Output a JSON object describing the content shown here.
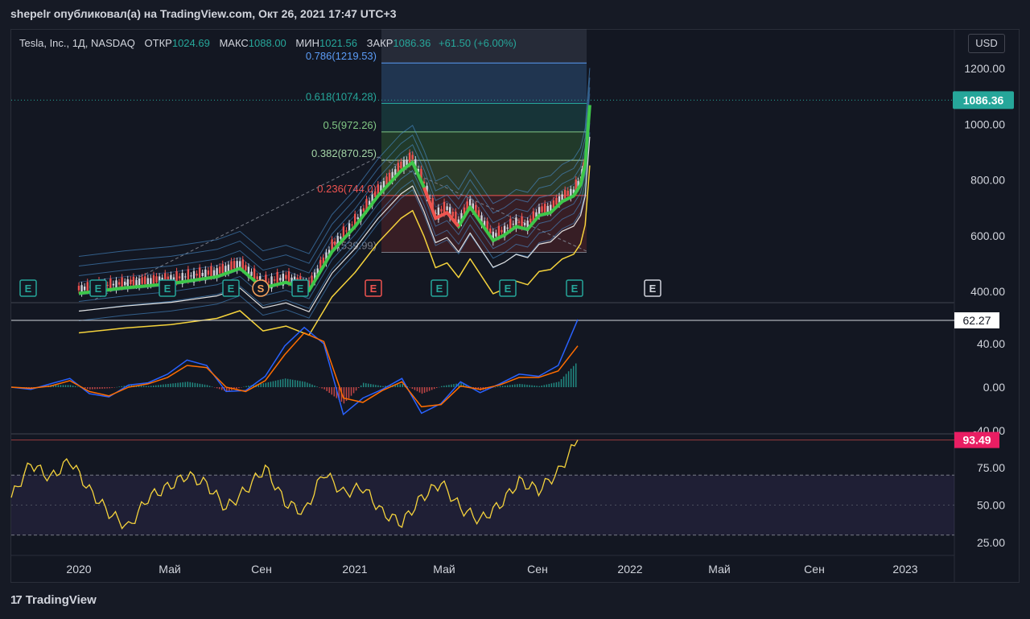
{
  "header": {
    "text": "shepelr опубликовал(а) на TradingView.com, Окт 26, 2021 17:47 UTC+3"
  },
  "legend": {
    "symbol": "Tesla, Inc., 1Д, NASDAQ",
    "open_label": "ОТКР",
    "open": "1024.69",
    "high_label": "МАКС",
    "high": "1088.00",
    "low_label": "МИН",
    "low": "1021.56",
    "close_label": "ЗАКР",
    "close": "1086.36",
    "change": "+61.50 (+6.00%)"
  },
  "currency": "USD",
  "footer": {
    "brand": "TradingView",
    "logo": "17"
  },
  "colors": {
    "bg": "#131722",
    "up": "#26a69a",
    "down": "#ef5350",
    "rsi": "#f5d33c",
    "macd": "#2962ff",
    "signal": "#ff6d00"
  },
  "events": [
    {
      "label": "E",
      "type": "earnings"
    },
    {
      "label": "E",
      "type": "earnings"
    },
    {
      "label": "E",
      "type": "earnings"
    },
    {
      "label": "E",
      "type": "earnings"
    },
    {
      "label": "S",
      "type": "split"
    },
    {
      "label": "E",
      "type": "earnings"
    },
    {
      "label": "E",
      "type": "earnings-negative"
    },
    {
      "label": "E",
      "type": "earnings"
    },
    {
      "label": "E",
      "type": "earnings"
    },
    {
      "label": "E",
      "type": "earnings"
    },
    {
      "label": "E",
      "type": "earnings-upcoming"
    }
  ],
  "chart_data": [
    {
      "type": "candlestick",
      "title": "Tesla, Inc., 1Д, NASDAQ",
      "y_ticks": [
        "1200.00",
        "1000.00",
        "800.00",
        "600.00",
        "400.00"
      ],
      "ylim": [
        380,
        1240
      ],
      "last_price": "1086.36",
      "fib_levels": [
        {
          "label": "0.786(1219.53)",
          "value": 1219.53,
          "color": "#5b9cf6"
        },
        {
          "label": "0.618(1074.28)",
          "value": 1074.28,
          "color": "#26a69a"
        },
        {
          "label": "0.5(972.26)",
          "value": 972.26,
          "color": "#81c784"
        },
        {
          "label": "0.382(870.25)",
          "value": 870.25,
          "color": "#a5d6a7"
        },
        {
          "label": "0.236(744.0)",
          "value": 744.0,
          "color": "#ef5350"
        },
        {
          "label": "0(539.99)",
          "value": 539.99,
          "color": "#787b86"
        }
      ],
      "price_path": [
        {
          "m": 0,
          "p": 410
        },
        {
          "m": 2,
          "p": 430
        },
        {
          "m": 4,
          "p": 445
        },
        {
          "m": 6,
          "p": 470
        },
        {
          "m": 7,
          "p": 500
        },
        {
          "m": 8,
          "p": 430
        },
        {
          "m": 9,
          "p": 450
        },
        {
          "m": 10,
          "p": 420
        },
        {
          "m": 11,
          "p": 560
        },
        {
          "m": 12,
          "p": 650
        },
        {
          "m": 13,
          "p": 760
        },
        {
          "m": 14,
          "p": 850
        },
        {
          "m": 14.5,
          "p": 880
        },
        {
          "m": 15,
          "p": 790
        },
        {
          "m": 15.5,
          "p": 680
        },
        {
          "m": 16,
          "p": 700
        },
        {
          "m": 16.5,
          "p": 650
        },
        {
          "m": 17,
          "p": 720
        },
        {
          "m": 17.5,
          "p": 660
        },
        {
          "m": 18,
          "p": 600
        },
        {
          "m": 18.5,
          "p": 620
        },
        {
          "m": 19,
          "p": 650
        },
        {
          "m": 19.5,
          "p": 640
        },
        {
          "m": 20,
          "p": 690
        },
        {
          "m": 20.5,
          "p": 700
        },
        {
          "m": 21,
          "p": 740
        },
        {
          "m": 21.5,
          "p": 760
        },
        {
          "m": 21.8,
          "p": 800
        },
        {
          "m": 22,
          "p": 870
        },
        {
          "m": 22.2,
          "p": 1086
        }
      ]
    },
    {
      "type": "line",
      "indicator": "MACD",
      "y_ticks": [
        "40.00",
        "0.00",
        "-40.00"
      ],
      "ylim": [
        -45,
        68
      ],
      "last_value": "62.27",
      "series": [
        {
          "values": [
            0,
            -2,
            3,
            8,
            -6,
            -9,
            2,
            4,
            12,
            25,
            20,
            -4,
            -3,
            10,
            38,
            55,
            40,
            -25,
            -10,
            -2,
            8,
            -24,
            -15,
            5,
            -5,
            3,
            12,
            10,
            20,
            62.27
          ],
          "color": "#2962ff"
        },
        {
          "values": [
            0,
            -1,
            1,
            6,
            -4,
            -8,
            0,
            3,
            9,
            20,
            18,
            0,
            -4,
            6,
            30,
            50,
            42,
            -10,
            -14,
            -3,
            5,
            -18,
            -16,
            1,
            -2,
            2,
            9,
            9,
            15,
            38
          ],
          "color": "#ff6d00"
        }
      ]
    },
    {
      "type": "line",
      "indicator": "RSI",
      "y_ticks": [
        "75.00",
        "50.00",
        "25.00"
      ],
      "ylim": [
        20,
        95
      ],
      "last_value": "93.49",
      "series": [
        {
          "values": [
            55,
            78,
            68,
            80,
            60,
            45,
            35,
            55,
            62,
            70,
            64,
            48,
            60,
            75,
            52,
            45,
            72,
            58,
            62,
            45,
            38,
            55,
            65,
            48,
            40,
            50,
            66,
            60,
            72,
            93.49
          ],
          "color": "#f5d33c"
        }
      ]
    }
  ],
  "x_axis": {
    "ticks": [
      "2020",
      "Май",
      "Сен",
      "2021",
      "Май",
      "Сен",
      "2022",
      "Май",
      "Сен",
      "2023"
    ]
  }
}
